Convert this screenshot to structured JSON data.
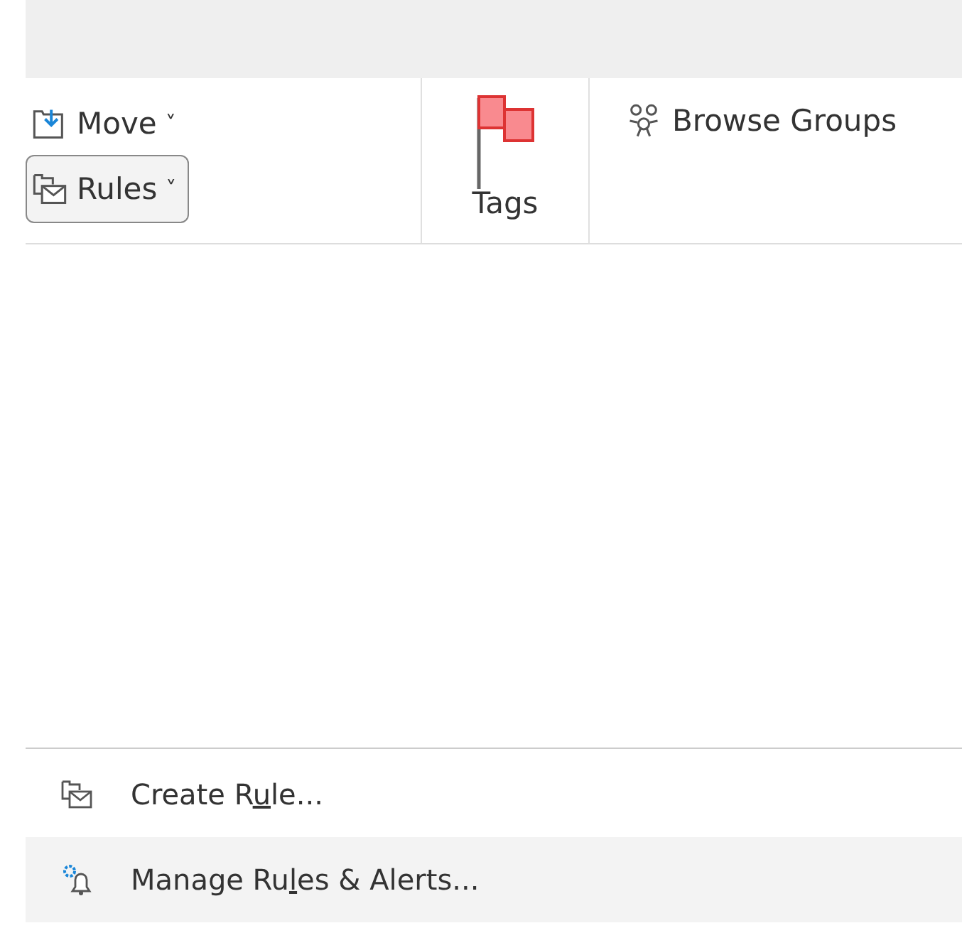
{
  "ribbon": {
    "move": {
      "label": "Move",
      "caret": "˅"
    },
    "rules": {
      "label": "Rules",
      "caret": "˅",
      "pressed": true
    },
    "tags": {
      "label": "Tags"
    },
    "browse_groups": {
      "label": "Browse Groups"
    }
  },
  "menu": {
    "items": [
      {
        "kind": "create",
        "before": "Create R",
        "access_key": "u",
        "after": "le...",
        "selected": false
      },
      {
        "kind": "manage",
        "before": "Manage Ru",
        "access_key": "l",
        "after": "es & Alerts...",
        "selected": true
      }
    ]
  }
}
